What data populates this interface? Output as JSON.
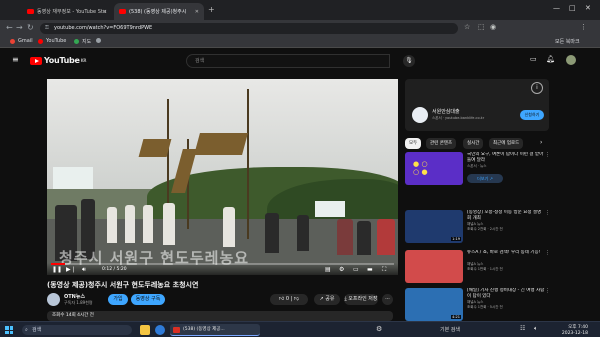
{
  "browser": {
    "tabs": [
      {
        "label": "동영상 재무정보 - YouTube Stu",
        "active": false
      },
      {
        "label": "(538) (동영상 제공)청주시 ",
        "active": true
      }
    ],
    "new_tab_label": "+",
    "address": "youtube.com/watch?v=FO69T9nrdPWE",
    "bookmarks": [
      {
        "label": "Gmail",
        "color": "#ea4335"
      },
      {
        "label": "YouTube",
        "color": "#ff0000"
      },
      {
        "label": "지도",
        "color": "#34a853"
      }
    ],
    "all_bookmarks_label": "모든 북마크"
  },
  "youtube": {
    "logo_text": "YouTube",
    "logo_region": "KR",
    "search_placeholder": "검색",
    "video": {
      "overlay_text": "청주시 서원구 현도두레농요",
      "time": "0:12 / 5:20",
      "progress": 0.04
    },
    "title": "(동영상 제공)청주시 서원구 현도두레농요 초청시연",
    "channel": {
      "name": "OTN뉴스",
      "subs": "구독자 1.89천명"
    },
    "join_label": "가입",
    "subscribe_label": "동영상 구독",
    "like_count": "0",
    "share_label": "공유",
    "save_label": "오프라인 저장",
    "more_label": "···",
    "description": "조회수 14회  4시간 전"
  },
  "ad": {
    "title": "서원안심대출",
    "subtitle": "스폰서 · youtube.banklife.co.kr",
    "button": "신청하기"
  },
  "chips": [
    {
      "label": "모두",
      "on": true
    },
    {
      "label": "관련 콘텐츠",
      "on": false
    },
    {
      "label": "실시간",
      "on": false
    },
    {
      "label": "최근에 업로드",
      "on": false
    }
  ],
  "recommendations": [
    {
      "title": "국민의 요구, 여론이 답이다 이런 걸 받아들여 달라",
      "channel": "스폰서 · 뉴스",
      "meta": "",
      "duration": "",
      "thumb": "#5b2ec7"
    },
    {
      "title": "[동영상] 오송·청정 이동 방문 요청 설명회 개최",
      "channel": "채널A 뉴스",
      "meta": "조회수 2천회 · 2시간 전",
      "duration": "1:19",
      "thumb": "#1f3a6e"
    },
    {
      "title": "뉴스A / 쇼, 바로 검색! 우리 동네 기능!",
      "channel": "채널A 뉴스",
      "meta": "조회수 1만회 · 1시간 전",
      "duration": "",
      "thumb": "#d24b4b"
    },
    {
      "title": "[채널] 기사 진행 정비대상 - 긴 여행 사람이 답이 있다",
      "channel": "채널A 뉴스",
      "meta": "조회수 1천회 · 5시간 전",
      "duration": "4:21",
      "thumb": "#2c6fb3"
    }
  ],
  "taskbar": {
    "search_label": "검색",
    "task_label": "(538) (동영상 제공...",
    "lang": "기본  검색",
    "time": "오후 7:40",
    "date": "2023-12-18"
  }
}
